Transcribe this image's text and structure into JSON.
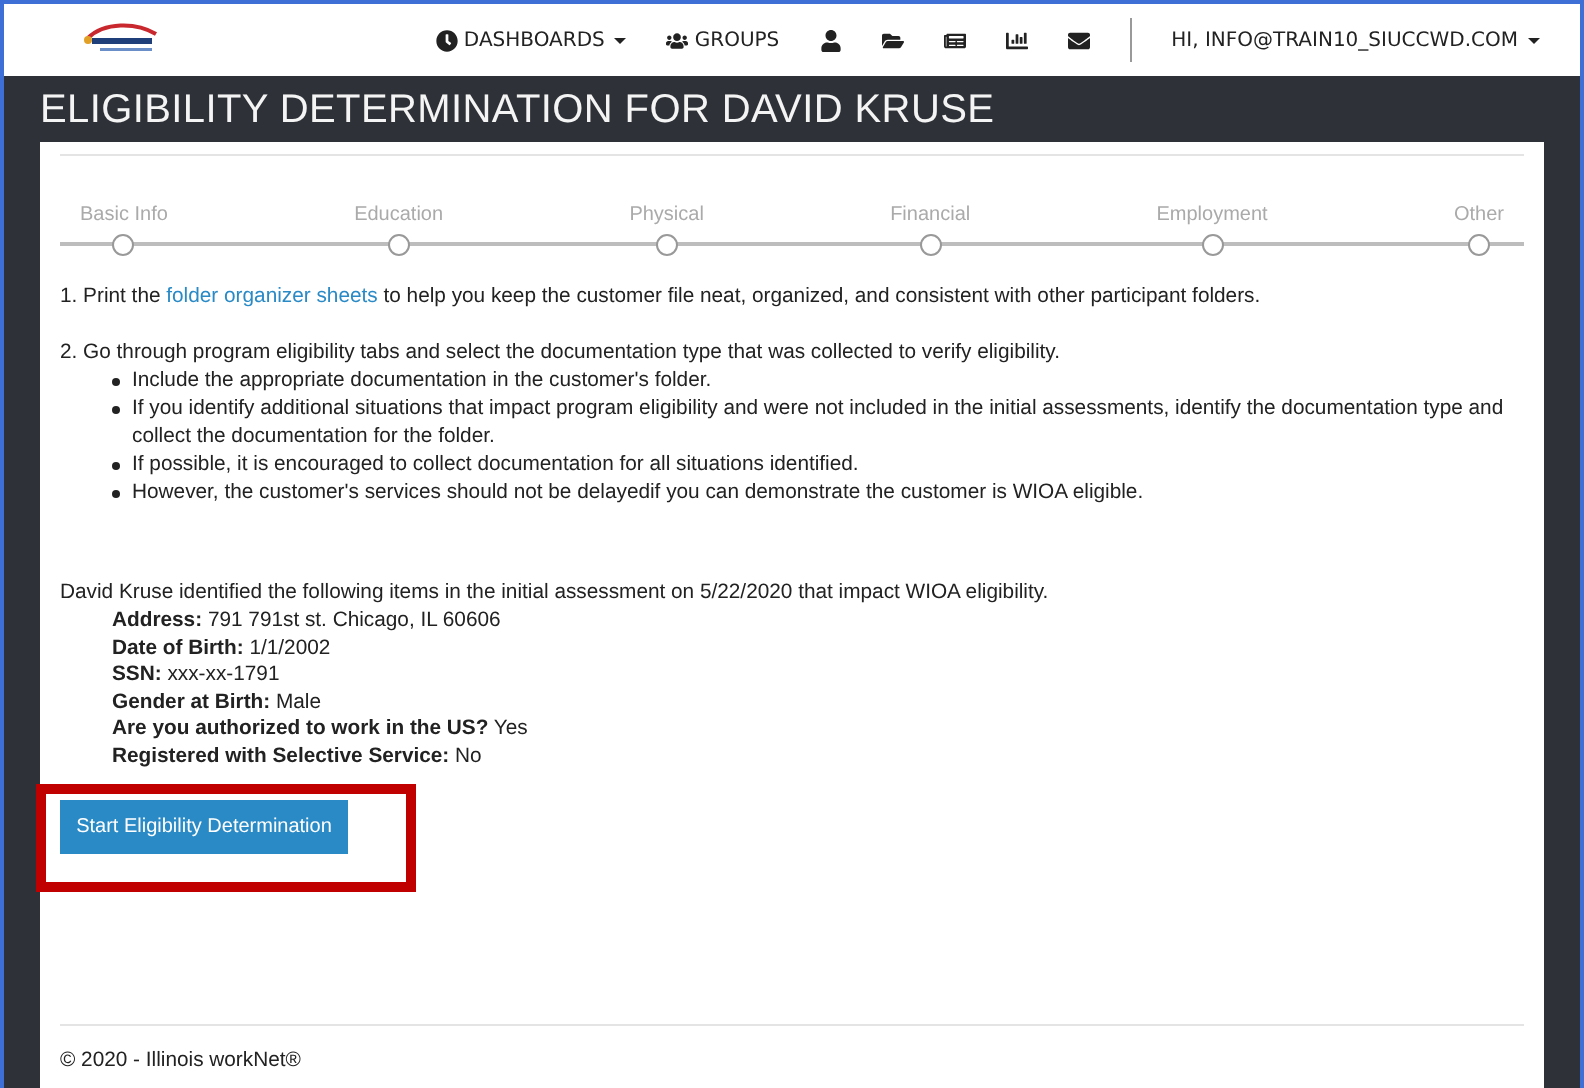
{
  "nav": {
    "items": [
      {
        "kind": "dashboards",
        "label": "DASHBOARDS",
        "dropdown": true
      },
      {
        "kind": "groups",
        "label": "GROUPS",
        "dropdown": false
      },
      {
        "kind": "profile"
      },
      {
        "kind": "folder"
      },
      {
        "kind": "document"
      },
      {
        "kind": "chart"
      },
      {
        "kind": "mail"
      }
    ],
    "user": {
      "label": "HI, INFO@TRAIN10_SIUCCWD.COM",
      "dropdown": true
    }
  },
  "title": "ELIGIBILITY DETERMINATION FOR DAVID KRUSE",
  "steps": [
    {
      "label": "Basic Info",
      "selected": false
    },
    {
      "label": "Education",
      "selected": false
    },
    {
      "label": "Physical",
      "selected": false
    },
    {
      "label": "Financial",
      "selected": false
    },
    {
      "label": "Employment",
      "selected": false
    },
    {
      "label": "Other",
      "selected": false
    }
  ],
  "instructions": {
    "first": {
      "before": "1. Print the",
      "link": "folder organizer sheets",
      "after": "to help you keep the customer file neat, organized, and consistent with other participant folders."
    },
    "second": {
      "text": "2. Go through program eligibility tabs and select the documentation type that was collected to verify eligibility.",
      "bullets": [
        "Include the appropriate documentation in the customer's folder.",
        "If you identify additional situations that impact program eligibility and were not included in the initial assessments, identify the documentation type and collect the documentation for the folder.",
        "If possible, it is encouraged to collect documentation for all situations identified.",
        "However, the customer's services should not be delayedif you can demonstrate the customer is WIOA eligible."
      ]
    }
  },
  "assessment": {
    "intro": "David Kruse identified the following items in the initial assessment on 5/22/2020 that impact WIOA eligibility.",
    "details": [
      {
        "label": "Address:",
        "value": "791 791st st. Chicago, IL 60606"
      },
      {
        "label": "Date of Birth:",
        "value": "1/1/2002"
      },
      {
        "label": "SSN:",
        "value": "xxx-xx-1791"
      },
      {
        "label": "Gender at Birth:",
        "value": "Male"
      },
      {
        "label": "Are you authorized to work in the US?",
        "value": "Yes"
      },
      {
        "label": "Registered with Selective Service:",
        "value": "No"
      }
    ],
    "button": {
      "label": "Start Eligibility Determination",
      "highlighted": true
    }
  },
  "footer": "© 2020 - Illinois workNet®"
}
